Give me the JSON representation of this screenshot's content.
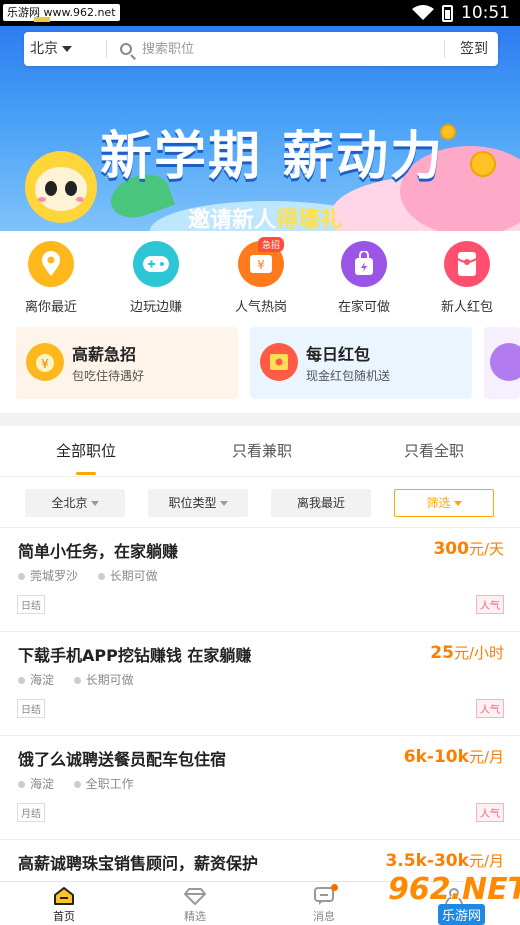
{
  "status_bar": {
    "watermark": "乐游网 www.962.net",
    "time": "10:51"
  },
  "search": {
    "city": "北京",
    "placeholder": "搜索职位",
    "checkin": "签到"
  },
  "banner": {
    "title": "新学期 薪动力",
    "subtitle_prefix": "邀请新人",
    "subtitle_highlight": "得壕礼"
  },
  "categories": [
    {
      "label": "离你最近",
      "icon": "location-icon",
      "color": "#ffb81c"
    },
    {
      "label": "边玩边赚",
      "icon": "gamepad-icon",
      "color": "#2cc6d6"
    },
    {
      "label": "人气热岗",
      "icon": "money-box-icon",
      "color": "#ff7a1a",
      "badge": "急招"
    },
    {
      "label": "在家可做",
      "icon": "bag-icon",
      "color": "#9b55e6"
    },
    {
      "label": "新人红包",
      "icon": "red-packet-icon",
      "color": "#ff4f6e"
    }
  ],
  "promos": [
    {
      "title": "高薪急招",
      "subtitle": "包吃住待遇好",
      "icon": "coin-bag-icon"
    },
    {
      "title": "每日红包",
      "subtitle": "现金红包随机送",
      "icon": "red-envelope-icon"
    }
  ],
  "tabs": [
    {
      "label": "全部职位",
      "active": true
    },
    {
      "label": "只看兼职",
      "active": false
    },
    {
      "label": "只看全职",
      "active": false
    }
  ],
  "filters": [
    {
      "label": "全北京",
      "highlight": false
    },
    {
      "label": "职位类型",
      "highlight": false
    },
    {
      "label": "离我最近",
      "highlight": false
    },
    {
      "label": "筛选",
      "highlight": true
    }
  ],
  "jobs": [
    {
      "title": "简单小任务，在家躺赚",
      "salary": "300",
      "unit": "元/天",
      "location": "莞城罗沙",
      "type": "长期可做",
      "settle": "日结",
      "hot": "人气"
    },
    {
      "title": "下载手机APP挖钻赚钱 在家躺赚",
      "salary": "25",
      "unit": "元/小时",
      "location": "海淀",
      "type": "长期可做",
      "settle": "日结",
      "hot": "人气"
    },
    {
      "title": "饿了么诚聘送餐员配车包住宿",
      "salary": "6k-10k",
      "unit": "元/月",
      "location": "海淀",
      "type": "全职工作",
      "settle": "月结",
      "hot": "人气"
    },
    {
      "title": "高薪诚聘珠宝销售顾问，薪资保护",
      "salary": "3.5k-30k",
      "unit": "元/月",
      "location": "",
      "type": "",
      "settle": "",
      "hot": ""
    }
  ],
  "bottom_nav": [
    {
      "label": "首页",
      "icon": "home-icon",
      "active": true
    },
    {
      "label": "精选",
      "icon": "diamond-icon",
      "active": false
    },
    {
      "label": "消息",
      "icon": "message-icon",
      "active": false
    },
    {
      "label": "我的",
      "icon": "profile-icon",
      "active": false
    }
  ],
  "watermark": {
    "main": "962.NET",
    "sub": "乐游网"
  }
}
